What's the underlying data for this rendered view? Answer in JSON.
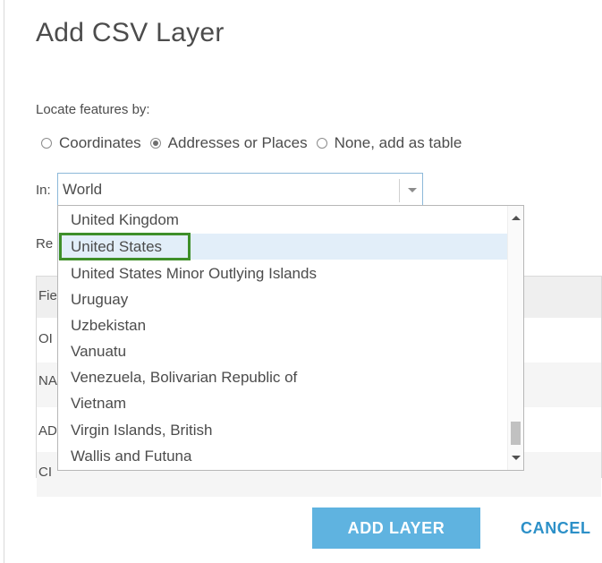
{
  "dialog": {
    "title": "Add CSV Layer",
    "locate_label": "Locate features by:",
    "radio_options": [
      {
        "label": "Coordinates",
        "checked": false
      },
      {
        "label": "Addresses or Places",
        "checked": true
      },
      {
        "label": "None, add as table",
        "checked": false
      }
    ],
    "in_label": "In:",
    "country_select": {
      "value": "World"
    },
    "background": {
      "section_label_fragment": "Re",
      "table_header_fragment": "Fie",
      "row_fragments": [
        "OI",
        "NA",
        "AD",
        "CI"
      ]
    },
    "country_list": [
      {
        "label": "United Kingdom"
      },
      {
        "label": "United States",
        "highlighted": true
      },
      {
        "label": "United States Minor Outlying Islands"
      },
      {
        "label": "Uruguay"
      },
      {
        "label": "Uzbekistan"
      },
      {
        "label": "Vanuatu"
      },
      {
        "label": "Venezuela, Bolivarian Republic of"
      },
      {
        "label": "Vietnam"
      },
      {
        "label": "Virgin Islands, British"
      },
      {
        "label": "Wallis and Futuna"
      }
    ],
    "add_button": "ADD LAYER",
    "cancel_button": "CANCEL"
  },
  "colors": {
    "accent_button": "#5fb3e0",
    "cancel_text": "#2c90c8",
    "highlight_row": "#e2eef9",
    "annotation_box": "#3f8f2a"
  }
}
